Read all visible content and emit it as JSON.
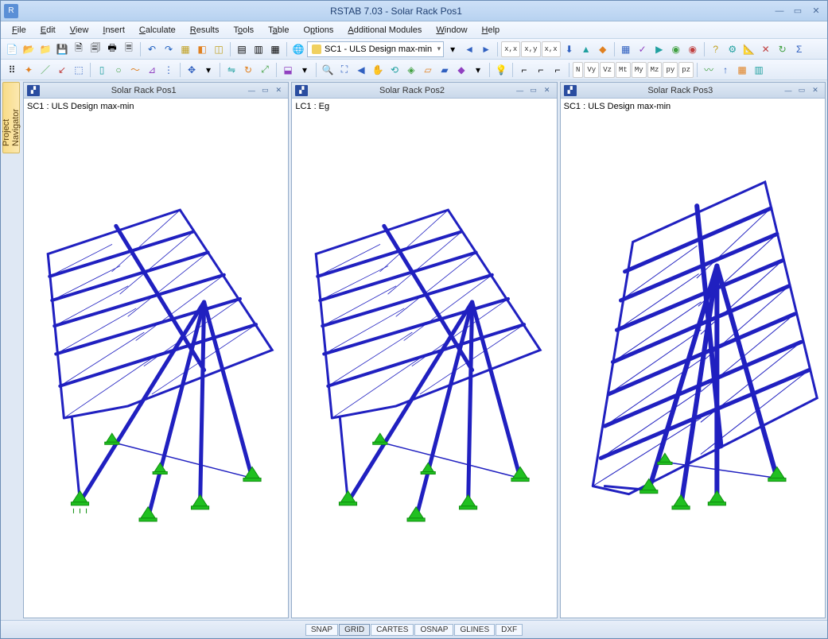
{
  "titlebar": {
    "title": "RSTAB 7.03 - Solar Rack Pos1"
  },
  "menubar": {
    "items": [
      "File",
      "Edit",
      "View",
      "Insert",
      "Calculate",
      "Results",
      "Tools",
      "Table",
      "Options",
      "Additional Modules",
      "Window",
      "Help"
    ]
  },
  "loadcase_combo": "SC1 - ULS Design max-min",
  "sidebar": {
    "label": "Project Navigator"
  },
  "views": [
    {
      "title": "Solar Rack Pos1",
      "case": "SC1 : ULS Design max-min"
    },
    {
      "title": "Solar Rack Pos2",
      "case": "LC1 : Eg"
    },
    {
      "title": "Solar Rack Pos3",
      "case": "SC1 : ULS Design max-min"
    }
  ],
  "statusbar": [
    "SNAP",
    "GRID",
    "CARTES",
    "OSNAP",
    "GLINES",
    "DXF"
  ],
  "icons": {
    "new": "new-file-icon",
    "open": "open-folder-icon",
    "save": "save-icon",
    "print": "print-icon",
    "undo": "undo-icon",
    "redo": "redo-icon",
    "nav-prev": "nav-prev-icon",
    "nav-next": "nav-next-icon"
  },
  "toolbar_labels": {
    "xx": "x,x",
    "xy": "x,y",
    "xxt": "x,x",
    "N": "N",
    "Vy": "Vy",
    "Vz": "Vz",
    "Mt": "Mt",
    "My": "My",
    "Mz": "Mz",
    "py": "py",
    "pz": "pz"
  }
}
